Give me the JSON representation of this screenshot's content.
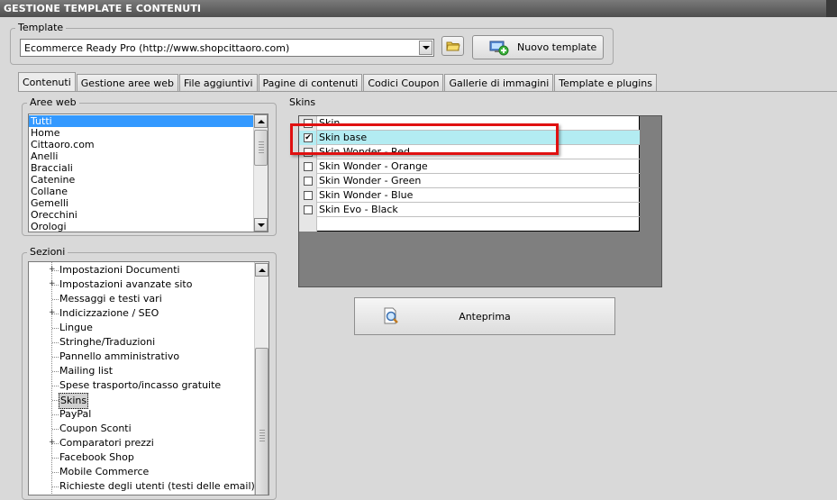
{
  "window": {
    "title": "GESTIONE TEMPLATE E CONTENUTI"
  },
  "template_group": {
    "label": "Template",
    "selected_value": "Ecommerce Ready Pro (http://www.shopcittaoro.com)",
    "new_template_label": "Nuovo template"
  },
  "tabs": [
    {
      "label": "Contenuti",
      "active": true
    },
    {
      "label": "Gestione aree web"
    },
    {
      "label": "File aggiuntivi"
    },
    {
      "label": "Pagine di contenuti"
    },
    {
      "label": "Codici Coupon"
    },
    {
      "label": "Gallerie di immagini"
    },
    {
      "label": "Template e plugins"
    }
  ],
  "aree_web": {
    "label": "Aree web",
    "items": [
      "Tutti",
      "Home",
      "Cittaoro.com",
      "Anelli",
      "Bracciali",
      "Catenine",
      "Collane",
      "Gemelli",
      "Orecchini",
      "Orologi"
    ],
    "selected": "Tutti"
  },
  "sezioni": {
    "label": "Sezioni",
    "items": [
      {
        "label": "Impostazioni Documenti",
        "expandable": true
      },
      {
        "label": "Impostazioni avanzate sito",
        "expandable": true
      },
      {
        "label": "Messaggi e testi vari",
        "expandable": false
      },
      {
        "label": "Indicizzazione / SEO",
        "expandable": true
      },
      {
        "label": "Lingue",
        "expandable": false
      },
      {
        "label": "Stringhe/Traduzioni",
        "expandable": false
      },
      {
        "label": "Pannello amministrativo",
        "expandable": false
      },
      {
        "label": "Mailing list",
        "expandable": false
      },
      {
        "label": "Spese trasporto/incasso gratuite",
        "expandable": false
      },
      {
        "label": "Skins",
        "expandable": false,
        "selected": true
      },
      {
        "label": "PayPal",
        "expandable": false
      },
      {
        "label": "Coupon Sconti",
        "expandable": false
      },
      {
        "label": "Comparatori prezzi",
        "expandable": true
      },
      {
        "label": "Facebook Shop",
        "expandable": false
      },
      {
        "label": "Mobile Commerce",
        "expandable": false
      },
      {
        "label": "Richieste degli utenti (testi delle email)",
        "expandable": false
      }
    ]
  },
  "skins": {
    "label": "Skins",
    "rows": [
      {
        "label": "Skin",
        "checked": false
      },
      {
        "label": "Skin base",
        "checked": true,
        "selected": true
      },
      {
        "label": "Skin Wonder - Red",
        "checked": false
      },
      {
        "label": "Skin Wonder - Orange",
        "checked": false
      },
      {
        "label": "Skin Wonder - Green",
        "checked": false
      },
      {
        "label": "Skin Wonder - Blue",
        "checked": false
      },
      {
        "label": "Skin Evo - Black",
        "checked": false
      }
    ],
    "preview_label": "Anteprima",
    "highlight_color": "#e01010"
  },
  "icons": {
    "folder": "folder-open-icon",
    "new_template": "monitor-add-icon",
    "preview": "document-magnifier-icon",
    "check": "✔"
  }
}
